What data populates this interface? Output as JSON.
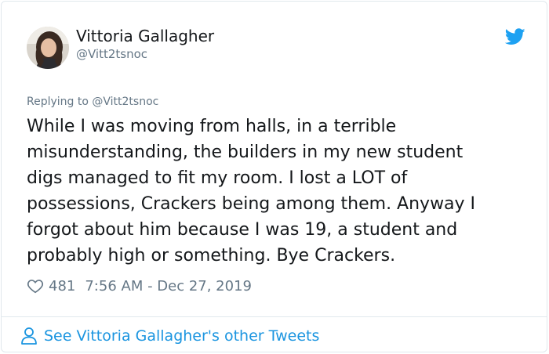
{
  "author": {
    "name": "Vittoria Gallagher",
    "handle": "@Vitt2tsnoc"
  },
  "reply": {
    "prefix": "Replying to ",
    "to_handle": "@Vitt2tsnoc"
  },
  "tweet": {
    "text": "While I was moving from halls, in a terrible\nmisunderstanding, the builders in my new student\ndigs managed to fit my room. I lost a LOT of\npossessions, Crackers being among them. Anyway I\nforgot about him because I was 19, a student and\nprobably high or something. Bye Crackers.",
    "likes": "481",
    "timestamp": "7:56 AM - Dec 27, 2019"
  },
  "footer": {
    "link_text": "See Vittoria Gallagher's other Tweets"
  },
  "icons": {
    "brand": "twitter-bird-icon",
    "like": "heart-outline-icon",
    "profile": "person-outline-icon"
  },
  "colors": {
    "brand_blue": "#1da1f2",
    "link_blue": "#1b95e0",
    "secondary_text": "#657786",
    "border": "#e1e8ed"
  }
}
